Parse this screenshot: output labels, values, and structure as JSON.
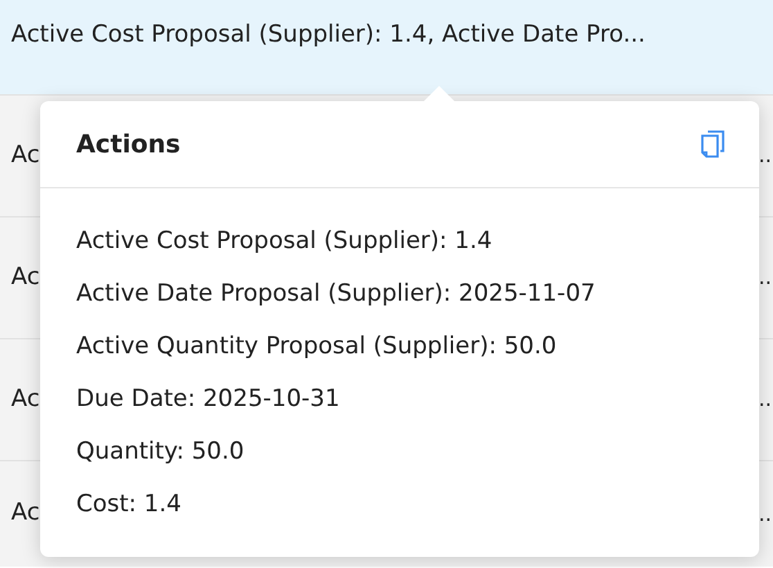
{
  "rows": [
    {
      "text": "Active Cost Proposal (Supplier): 1.4, Active Date Pro...",
      "selected": true
    },
    {
      "text_start": "Ac",
      "text_end": "..",
      "selected": false
    },
    {
      "text_start": "Ac",
      "text_end": "..",
      "selected": false
    },
    {
      "text_start": "Ac",
      "text_end": "..",
      "selected": false
    },
    {
      "text_start": "Ac",
      "text_end": "..",
      "selected": false
    }
  ],
  "popover": {
    "title": "Actions",
    "lines": [
      "Active Cost Proposal (Supplier): 1.4",
      "Active Date Proposal (Supplier): 2025-11-07",
      "Active Quantity Proposal (Supplier): 50.0",
      "Due Date: 2025-10-31",
      "Quantity: 50.0",
      "Cost: 1.4"
    ]
  }
}
